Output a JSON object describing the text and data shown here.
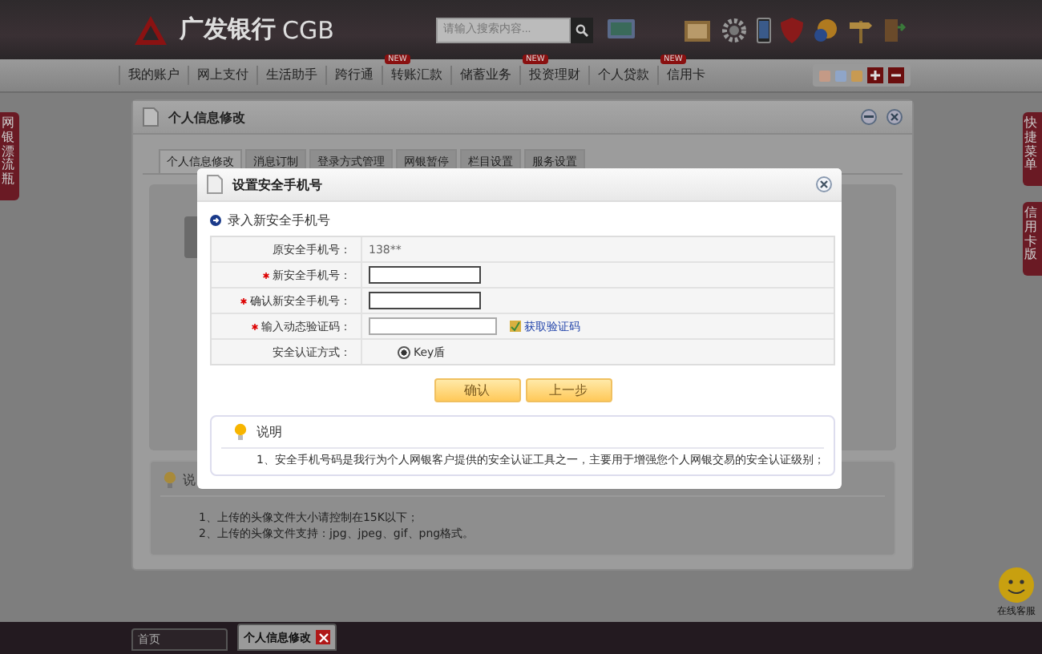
{
  "header": {
    "logo_text": "广发银行",
    "logo_latin": "CGB",
    "search": {
      "placeholder": "请输入搜索内容..."
    }
  },
  "nav": {
    "items": [
      {
        "label": "我的账户"
      },
      {
        "label": "网上支付"
      },
      {
        "label": "生活助手"
      },
      {
        "label": "跨行通"
      },
      {
        "label": "转账汇款",
        "badge": "NEW"
      },
      {
        "label": "储蓄业务"
      },
      {
        "label": "投资理财",
        "badge": "NEW"
      },
      {
        "label": "个人贷款"
      },
      {
        "label": "信用卡",
        "badge": "NEW"
      }
    ],
    "swatches": [
      {
        "color": "#c49a86"
      },
      {
        "color": "#8fa5c8"
      },
      {
        "color": "#c89a52"
      }
    ]
  },
  "left_tab": {
    "label": "网银漂流瓶"
  },
  "right_tabs": [
    {
      "label": "快捷菜单"
    },
    {
      "label": "信用卡版"
    }
  ],
  "panel": {
    "title": "个人信息修改",
    "tabs": [
      {
        "label": "个人信息修改",
        "selected": true
      },
      {
        "label": "消息订制",
        "selected": false
      },
      {
        "label": "登录方式管理",
        "selected": false
      },
      {
        "label": "网银暂停",
        "selected": false
      },
      {
        "label": "栏目设置",
        "selected": false
      },
      {
        "label": "服务设置",
        "selected": false
      }
    ],
    "note": {
      "title": "说",
      "lines": [
        "1、上传的头像文件大小请控制在15K以下；",
        "2、上传的头像文件支持：jpg、jpeg、gif、png格式。"
      ]
    }
  },
  "dialog": {
    "title": "设置安全手机号",
    "section": "录入新安全手机号",
    "rows": [
      {
        "kind": "text",
        "label": "原安全手机号：",
        "required": false,
        "value": "138**"
      },
      {
        "kind": "input",
        "label": "新安全手机号：",
        "required": true
      },
      {
        "kind": "input",
        "label": "确认新安全手机号：",
        "required": true
      },
      {
        "kind": "code",
        "label": "输入动态验证码：",
        "required": true,
        "link": "获取验证码"
      },
      {
        "kind": "radio",
        "label": "安全认证方式：",
        "required": false,
        "option": "Key盾",
        "checked": true
      }
    ],
    "buttons": [
      "确认",
      "上一步"
    ],
    "note": {
      "title": "说明",
      "lines": [
        "1、安全手机号码是我行为个人网银客户提供的安全认证工具之一，主要用于增强您个人网银交易的安全认证级别；"
      ]
    }
  },
  "taskbar": {
    "tabs": [
      {
        "label": "首页",
        "selected": false
      },
      {
        "label": "个人信息修改",
        "selected": true
      }
    ]
  },
  "service": {
    "label": "在线客服"
  }
}
